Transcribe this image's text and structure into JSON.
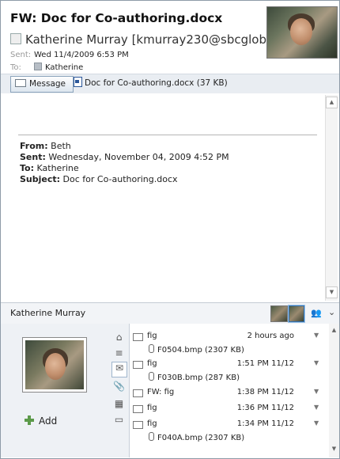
{
  "header": {
    "subject": "FW: Doc for Co-authoring.docx",
    "sender": "Katherine Murray [kmurray230@sbcglobal",
    "sent_label": "Sent:",
    "sent_value": "Wed 11/4/2009 6:53 PM",
    "to_label": "To:",
    "to_value": "Katherine"
  },
  "tabs": {
    "message_label": "Message",
    "attachment_label": "Doc for Co-authoring.docx (37 KB)"
  },
  "body": {
    "from_label": "From:",
    "from_value": "Beth",
    "sent_label": "Sent:",
    "sent_value": "Wednesday, November 04, 2009 4:52 PM",
    "to_label": "To:",
    "to_value": "Katherine",
    "subject_label": "Subject:",
    "subject_value": "Doc for Co-authoring.docx"
  },
  "people_pane": {
    "name": "Katherine Murray",
    "add_label": "Add"
  },
  "feed": [
    {
      "name": "fig",
      "time": "2 hours ago",
      "attachment": "F0504.bmp (2307 KB)"
    },
    {
      "name": "fig",
      "time": "1:51 PM  11/12",
      "attachment": "F030B.bmp (287 KB)"
    },
    {
      "name": "FW: fig",
      "time": "1:38 PM  11/12",
      "attachment": ""
    },
    {
      "name": "fig",
      "time": "1:36 PM  11/12",
      "attachment": ""
    },
    {
      "name": "fig",
      "time": "1:34 PM  11/12",
      "attachment": "F040A.bmp (2307 KB)"
    }
  ],
  "icons": {
    "scroll_up": "▲",
    "scroll_down": "▼",
    "dropdown": "▼",
    "home": "⌂",
    "rss": "≡",
    "mail": "✉",
    "clip": "📎",
    "calendar": "▦",
    "chat": "▭",
    "chevron": "⌄",
    "group": "👥"
  }
}
